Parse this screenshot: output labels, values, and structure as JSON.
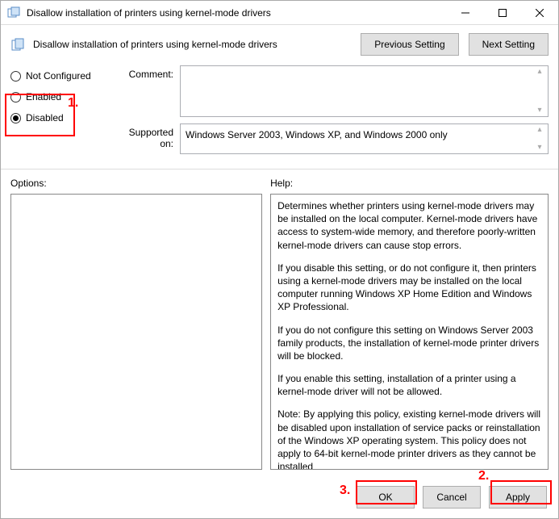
{
  "window": {
    "title": "Disallow installation of printers using kernel-mode drivers"
  },
  "header": {
    "title": "Disallow installation of printers using kernel-mode drivers",
    "previous_setting": "Previous Setting",
    "next_setting": "Next Setting"
  },
  "state": {
    "not_configured": "Not Configured",
    "enabled": "Enabled",
    "disabled": "Disabled",
    "selected": "disabled"
  },
  "fields": {
    "comment_label": "Comment:",
    "comment_value": "",
    "supported_label": "Supported on:",
    "supported_value": "Windows Server 2003, Windows XP, and Windows 2000 only"
  },
  "lower": {
    "options_label": "Options:",
    "help_label": "Help:"
  },
  "help_paragraphs": [
    "Determines whether printers using kernel-mode drivers may be installed on the local computer.  Kernel-mode drivers have access to system-wide memory, and therefore poorly-written kernel-mode drivers can cause stop errors.",
    "If you disable this setting, or do not configure it, then printers using a kernel-mode drivers may be installed on the local computer running Windows XP Home Edition and Windows XP Professional.",
    "If you do not configure this setting on Windows Server 2003 family products, the installation of kernel-mode printer drivers will be blocked.",
    "If you enable this setting, installation of a printer using a kernel-mode driver will not be allowed.",
    "Note: By applying this policy, existing kernel-mode drivers will be disabled upon installation of service packs or reinstallation of the Windows XP operating system. This policy does not apply to 64-bit kernel-mode printer drivers as they cannot be installed"
  ],
  "footer": {
    "ok": "OK",
    "cancel": "Cancel",
    "apply": "Apply"
  },
  "annotations": {
    "a1": "1.",
    "a2": "2.",
    "a3": "3."
  }
}
